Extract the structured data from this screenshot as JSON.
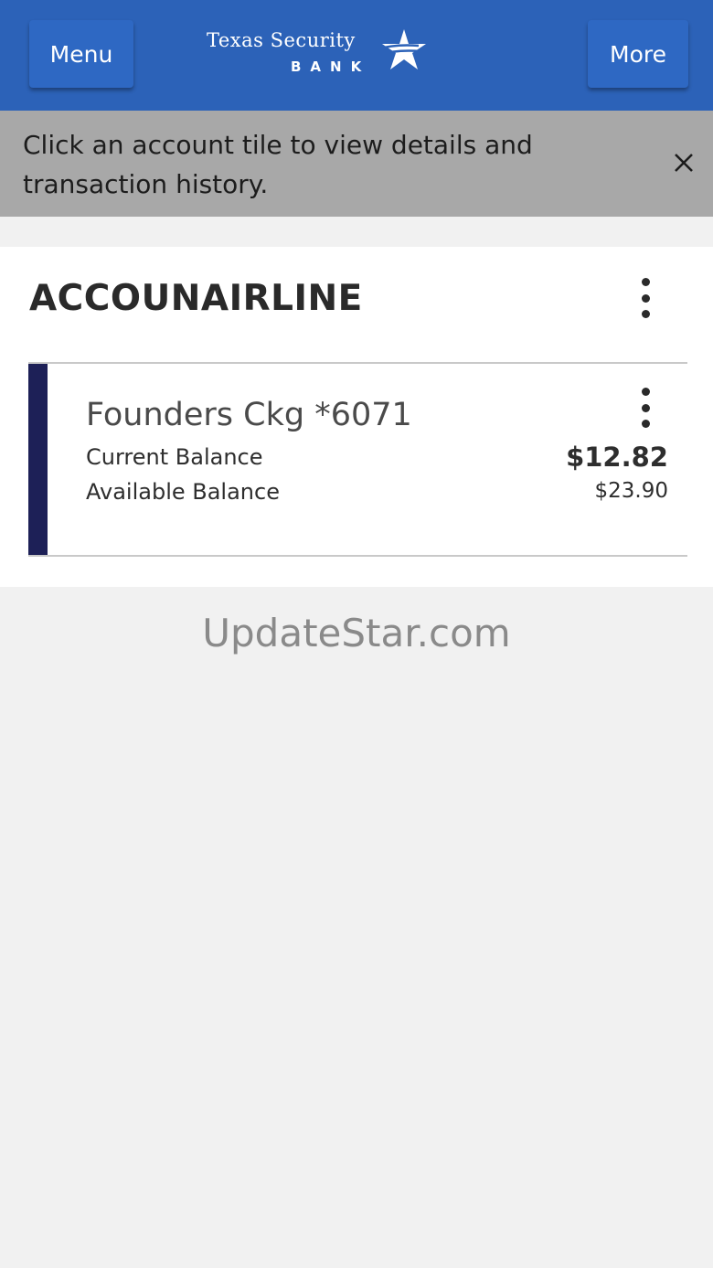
{
  "header": {
    "menu_label": "Menu",
    "more_label": "More",
    "logo": {
      "line1": "Texas Security",
      "line2": "BANK"
    },
    "colors": {
      "background": "#2c62b8",
      "button": "#2e68c3"
    }
  },
  "banner": {
    "message": "Click an account tile to view details and transaction history.",
    "close_icon": "close-icon"
  },
  "accounts_card": {
    "title": "ACCOUNAIRLINE",
    "menu_icon": "kebab-menu-icon",
    "tiles": [
      {
        "name": "Founders Ckg *6071",
        "current_balance_label": "Current Balance",
        "current_balance": "$12.82",
        "available_balance_label": "Available Balance",
        "available_balance": "$23.90",
        "stripe_color": "#1d2057",
        "menu_icon": "kebab-menu-icon"
      }
    ]
  },
  "watermark": "UpdateStar.com"
}
